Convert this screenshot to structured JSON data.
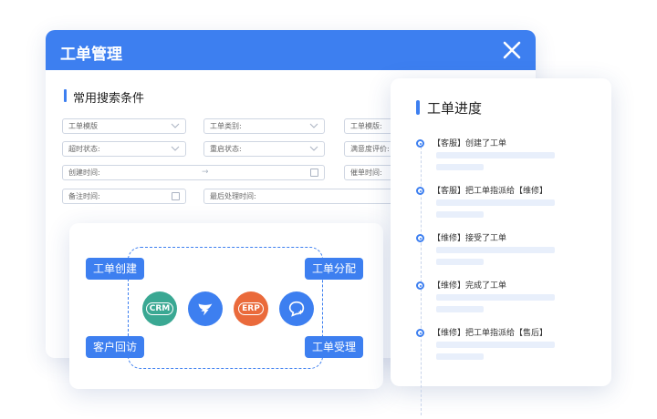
{
  "window": {
    "title": "工单管理",
    "section_title": "常用搜索条件",
    "fields": {
      "template1": "工单模版",
      "type": "工单类别:",
      "template2": "工单模版:",
      "overtime": "超时状态:",
      "reopen": "重启状态:",
      "satisfaction": "满意度评价:",
      "created": "创建时间:",
      "range_sep": "→",
      "reminder": "催单时间:",
      "note": "备注时间:",
      "last_handled": "最后处理时间:"
    }
  },
  "integration": {
    "tags": {
      "create": "工单创建",
      "assign": "工单分配",
      "visit": "客户回访",
      "accept": "工单受理"
    },
    "systems": {
      "crm": "CRM",
      "erp": "ERP",
      "crm_icon": "crm-badge-icon",
      "dingtalk_icon": "dingtalk-icon",
      "erp_icon": "erp-badge-icon",
      "chat_icon": "chat-bubble-icon"
    },
    "colors": {
      "crm": "#3aa893",
      "dingtalk": "#3d7ff0",
      "erp": "#ea6a3b",
      "chat": "#3d7ff0"
    }
  },
  "progress": {
    "title": "工单进度",
    "steps": [
      {
        "text": "【客服】创建了工单"
      },
      {
        "text": "【客服】把工单指派给【维修】"
      },
      {
        "text": "【维修】接受了工单"
      },
      {
        "text": "【维修】完成了工单"
      },
      {
        "text": "【维修】把工单指派给【售后】"
      }
    ]
  },
  "colors": {
    "accent": "#3d7ff0"
  }
}
